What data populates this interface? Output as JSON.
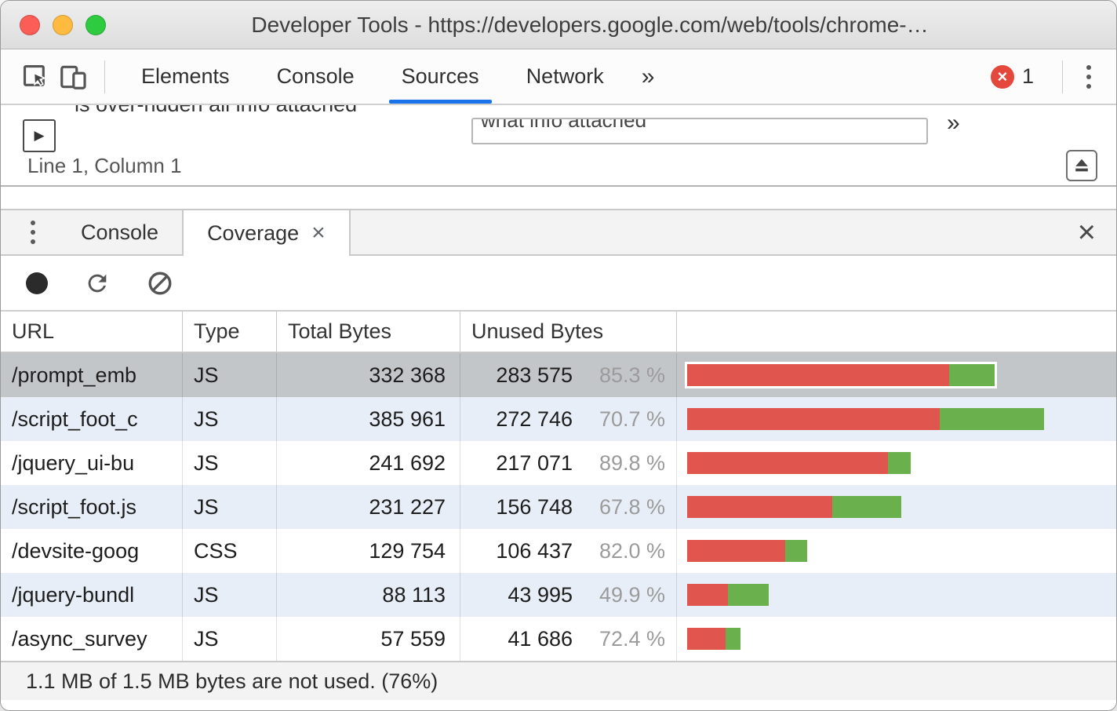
{
  "window": {
    "title": "Developer Tools - https://developers.google.com/web/tools/chrome-…"
  },
  "toolbar": {
    "tabs": [
      "Elements",
      "Console",
      "Sources",
      "Network"
    ],
    "active_tab": "Sources",
    "overflow_chevron": "»",
    "error_badge_count": "1",
    "error_color": "#e4483c",
    "accent_color": "#1a73e8"
  },
  "sources": {
    "peek_text": "is over-ridden all info attached",
    "peek_input_text": "what info attached",
    "peek_chevron": "»",
    "play_glyph": "▶",
    "status_line": "Line 1, Column 1"
  },
  "drawer": {
    "console_tab": "Console",
    "coverage_tab": "Coverage",
    "tab_close_symbol": "×",
    "drawer_close_symbol": "×"
  },
  "coverage": {
    "columns": [
      "URL",
      "Type",
      "Total Bytes",
      "Unused Bytes",
      ""
    ],
    "bar_colors": {
      "unused": "#e0564e",
      "used": "#6ab04c"
    },
    "rows": [
      {
        "url": "/prompt_emb",
        "type": "JS",
        "total": "332 368",
        "unused": "283 575",
        "pct": "85.3 %",
        "total_bytes": 332368,
        "unused_ratio": 0.853,
        "selected": true
      },
      {
        "url": "/script_foot_c",
        "type": "JS",
        "total": "385 961",
        "unused": "272 746",
        "pct": "70.7 %",
        "total_bytes": 385961,
        "unused_ratio": 0.707
      },
      {
        "url": "/jquery_ui-bu",
        "type": "JS",
        "total": "241 692",
        "unused": "217 071",
        "pct": "89.8 %",
        "total_bytes": 241692,
        "unused_ratio": 0.898
      },
      {
        "url": "/script_foot.js",
        "type": "JS",
        "total": "231 227",
        "unused": "156 748",
        "pct": "67.8 %",
        "total_bytes": 231227,
        "unused_ratio": 0.678
      },
      {
        "url": "/devsite-goog",
        "type": "CSS",
        "total": "129 754",
        "unused": "106 437",
        "pct": "82.0 %",
        "total_bytes": 129754,
        "unused_ratio": 0.82
      },
      {
        "url": "/jquery-bundl",
        "type": "JS",
        "total": "88 113",
        "unused": "43 995",
        "pct": "49.9 %",
        "total_bytes": 88113,
        "unused_ratio": 0.499
      },
      {
        "url": "/async_survey",
        "type": "JS",
        "total": "57 559",
        "unused": "41 686",
        "pct": "72.4 %",
        "total_bytes": 57559,
        "unused_ratio": 0.724
      }
    ],
    "footer": "1.1 MB of 1.5 MB bytes are not used. (76%)"
  }
}
